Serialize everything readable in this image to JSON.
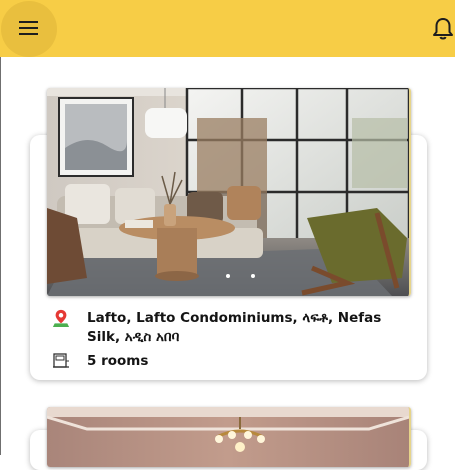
{
  "app_bar": {
    "menu_icon": "hamburger-menu-icon",
    "notification_icon": "bell-icon",
    "accent_color": "#f7cd46"
  },
  "listings": [
    {
      "location": "Lafto, Lafto Condominiums, ላፍቶ, Nefas Silk, አዲስ አበባ",
      "rooms": "5 rooms",
      "location_icon": "map-pin-icon",
      "rooms_icon": "bed-icon",
      "image_description": "living-room-photo"
    },
    {
      "image_description": "interior-room-photo"
    }
  ]
}
